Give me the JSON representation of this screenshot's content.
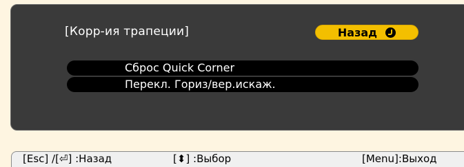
{
  "panel": {
    "title": "[Корр-ия трапеции]",
    "back_label": "Назад",
    "back_icon": "enter-icon"
  },
  "options": [
    {
      "label": "Сброс Quick Corner"
    },
    {
      "label": "Перекл. Гориз/вер.искаж."
    }
  ],
  "help_bar": {
    "back_hint": "[Esc] /[⏎] :Назад",
    "select_hint": "[⬍] :Выбор",
    "exit_hint": "[Menu]:Выход"
  },
  "colors": {
    "page_background": "#fef5e1",
    "panel_background": "#3a3a3a",
    "accent_button": "#f3bf00",
    "option_background": "#000000",
    "help_bar_background": "#f0f0f0"
  }
}
